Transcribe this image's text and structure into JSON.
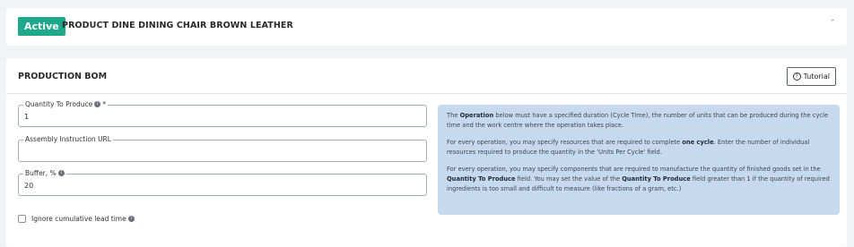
{
  "header": {
    "status_badge": "Active",
    "product_title": "PRODUCT DINE DINING CHAIR BROWN LEATHER"
  },
  "section": {
    "title": "PRODUCTION BOM",
    "tutorial_label": "Tutorial"
  },
  "fields": {
    "quantity": {
      "label": "Quantity To Produce",
      "required_mark": "*",
      "value": "1"
    },
    "assembly_url": {
      "label": "Assembly Instruction URL",
      "value": ""
    },
    "buffer": {
      "label": "Buffer, %",
      "value": "20"
    }
  },
  "checkbox": {
    "label": "Ignore cumulative lead time",
    "checked": false
  },
  "info": {
    "p1_pre": "The ",
    "p1_bold": "Operation",
    "p1_post": " below must have a specified duration (Cycle Time), the number of units that can be produced during the cycle time and the work centre where the operation takes place.",
    "p2_pre": "For every operation, you may specify resources that are required to complete ",
    "p2_bold": "one cycle",
    "p2_post": ". Enter the number of individual resources required to produce the quantity in the 'Units Per Cycle' field.",
    "p3_pre": "For every operation, you may specify components that are required to manufacture the quantity of finished goods set in the ",
    "p3_bold1": "Quantity To Produce",
    "p3_mid": " field. You may set the value of the ",
    "p3_bold2": "Quantity To Produce",
    "p3_post": " field greater than 1 if the quantity of required ingredients is too small and difficult to measure (like fractions of a gram, etc.)"
  },
  "icons": {
    "collapse": "chevron-up-icon",
    "info": "info-icon",
    "help": "help-circle-icon"
  },
  "colors": {
    "active_badge": "#1fa88a",
    "info_box_bg": "#c7d9ee"
  }
}
